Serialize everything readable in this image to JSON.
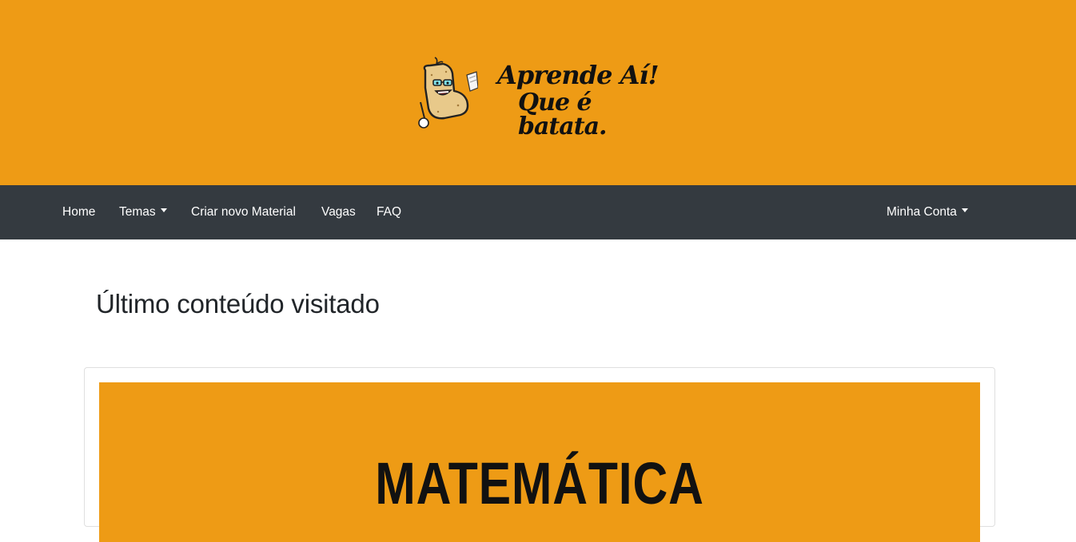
{
  "header": {
    "background_color": "#ee9b15",
    "logo": {
      "mascot_icon": "potato-mascot-icon",
      "line1": "Aprende Aí!",
      "line2": "Que é batata."
    }
  },
  "navbar": {
    "background_color": "#343a40",
    "items": [
      {
        "label": "Home",
        "dropdown": false
      },
      {
        "label": "Temas",
        "dropdown": true
      },
      {
        "label": "Criar novo Material",
        "dropdown": false
      },
      {
        "label": "Vagas",
        "dropdown": false
      },
      {
        "label": "FAQ",
        "dropdown": false
      }
    ],
    "account": {
      "label": "Minha Conta",
      "dropdown": true
    }
  },
  "main": {
    "title": "Último conteúdo visitado",
    "last_content_card": {
      "image_text": "MATEMÁTICA",
      "image_background": "#ee9b15"
    }
  }
}
